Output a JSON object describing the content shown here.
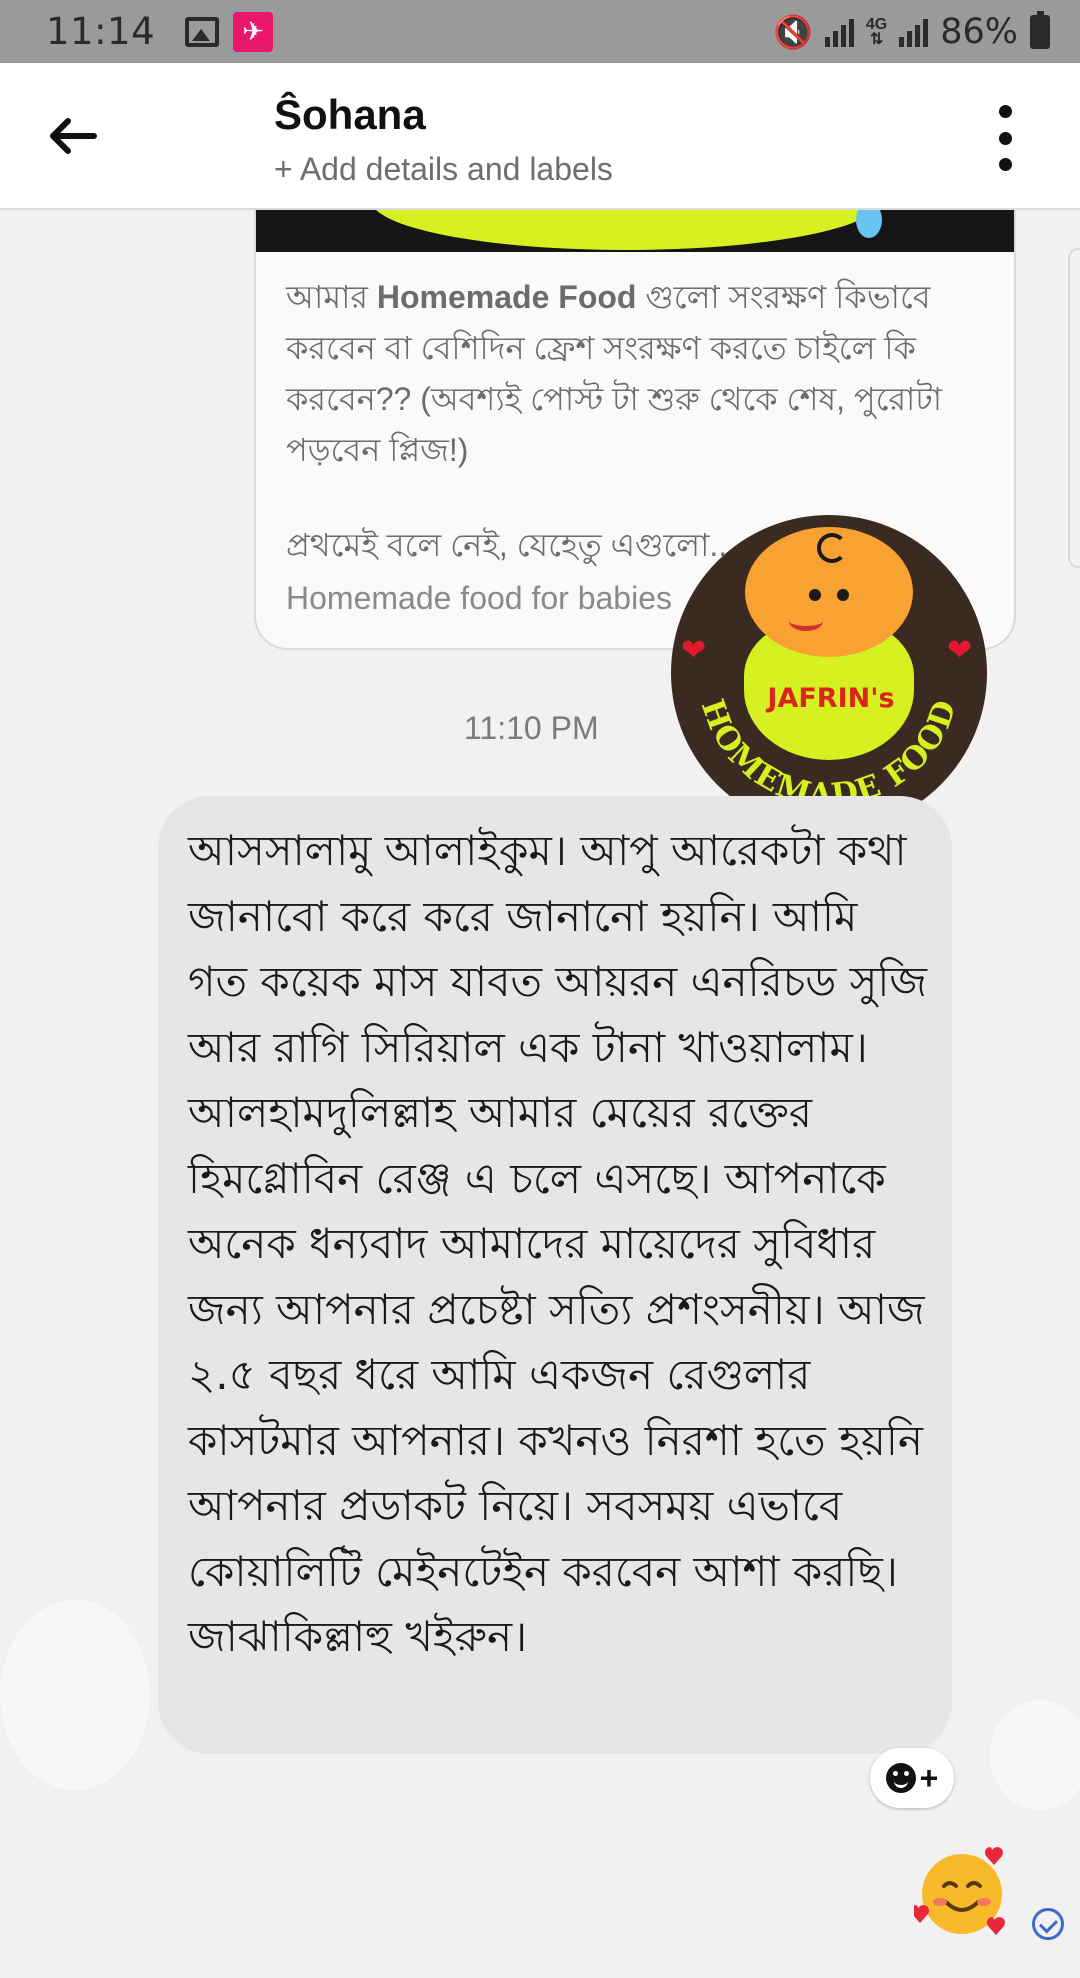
{
  "status_bar": {
    "time": "11:14",
    "network": "4G",
    "battery": "86%"
  },
  "header": {
    "contact_name": "Ŝohana",
    "subtitle": "+ Add details and labels"
  },
  "shared_post": {
    "text_prefix": "আমার ",
    "text_bold": "Homemade Food",
    "text_rest": " গুলো সংরক্ষণ কিভাবে করবেন বা বেশিদিন ফ্রেশ সংরক্ষণ করতে চাইলে কি করবেন?? (অবশ্যই পোস্ট টা শুরু থেকে শেষ, পুরোটা পড়বেন প্লিজ!)",
    "snippet": "প্রথমেই বলে নেই, যেহেতু এগুলো...",
    "caption": "Homemade food for babies"
  },
  "logo": {
    "brand": "JAFRIN's",
    "arc_text": "HOMEMADE FOOD"
  },
  "timestamp": "11:10 PM",
  "message": {
    "text": "আসসালামু আলাইকুম।  আপু আরেকটা কথা জানাবো করে করে জানানো হয়নি। আমি গত কয়েক মাস যাবত আয়রন এনরিচড সুজি আর রাগি সিরিয়াল এক টানা খাওয়ালাম।আলহামদুলিল্লাহ আমার মেয়ের রক্তের হিমগ্লোবিন রেঞ্জ এ চলে এসছে।  আপনাকে অনেক ধন্যবাদ আমাদের মায়েদের সুবিধার জন্য আপনার প্রচেষ্টা সত্যি প্রশংসনীয়।  আজ ২.৫ বছর ধরে আমি একজন রেগুলার কাসটমার আপনার। কখনও নিরশা হতে হয়নি আপনার প্রডাকট নিয়ে। সবসময় এভাবে কোয়ালিটি মেইনটেইন করবেন আশা করছি। জাঝাকিল্লাহু খইরুন।"
  },
  "reaction_button": {
    "plus": "+"
  },
  "sent_emoji": "🥰",
  "colors": {
    "status_bar_bg": "#9a9a9a",
    "bubble_bg": "#e6e6e6",
    "chat_bg": "#f1f1f1",
    "seen_icon": "#3b6bc9",
    "logo_accent": "#d6f022"
  }
}
